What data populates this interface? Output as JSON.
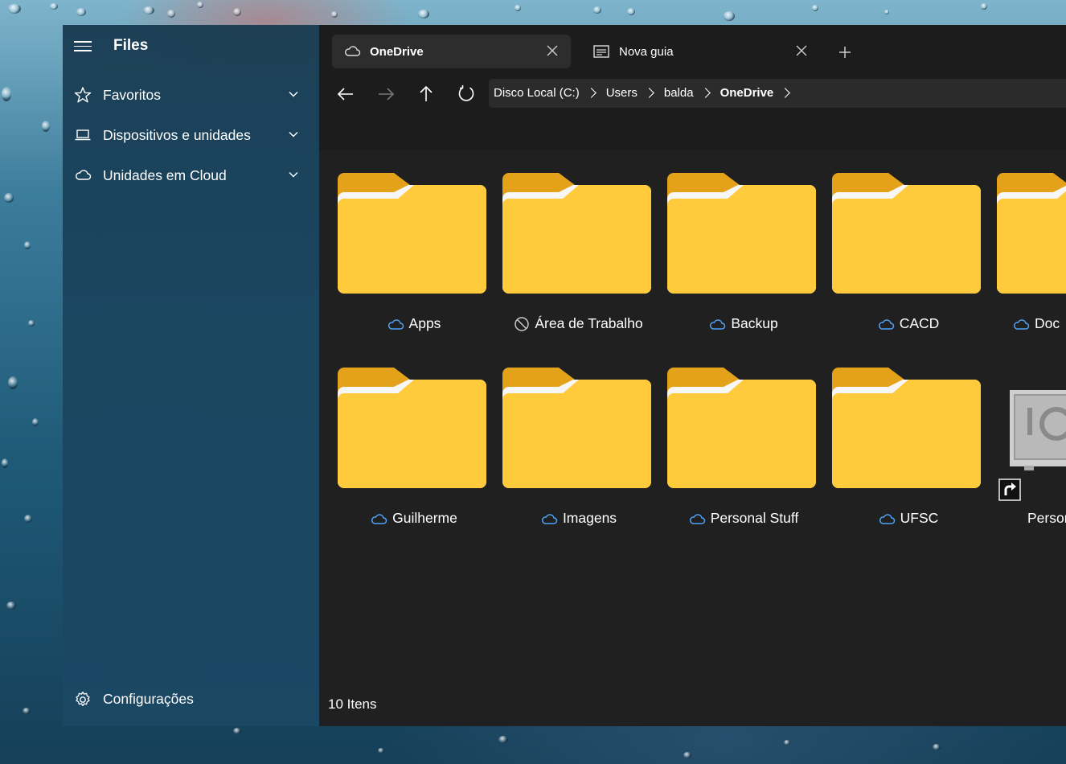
{
  "app": {
    "title": "Files"
  },
  "sidebar": {
    "items": [
      {
        "label": "Favoritos",
        "icon": "star-icon"
      },
      {
        "label": "Dispositivos e unidades",
        "icon": "laptop-icon"
      },
      {
        "label": "Unidades em Cloud",
        "icon": "cloud-icon"
      }
    ],
    "settings": {
      "label": "Configurações",
      "icon": "gear-icon"
    }
  },
  "tabs": [
    {
      "label": "OneDrive",
      "icon": "cloud-icon",
      "active": true
    },
    {
      "label": "Nova guia",
      "icon": "drive-icon",
      "active": false
    }
  ],
  "breadcrumb": [
    "Disco Local (C:)",
    "Users",
    "balda",
    "OneDrive"
  ],
  "items": [
    {
      "name": "Apps",
      "status": "cloud"
    },
    {
      "name": "Área de Trabalho",
      "status": "excluded"
    },
    {
      "name": "Backup",
      "status": "cloud"
    },
    {
      "name": "CACD",
      "status": "cloud"
    },
    {
      "name": "Doc",
      "status": "cloud"
    },
    {
      "name": "Guilherme",
      "status": "cloud"
    },
    {
      "name": "Imagens",
      "status": "cloud"
    },
    {
      "name": "Personal Stuff",
      "status": "cloud"
    },
    {
      "name": "UFSC",
      "status": "cloud"
    },
    {
      "name": "Persor",
      "status": "shortcut"
    }
  ],
  "status_bar": {
    "count": "10 Itens"
  },
  "colors": {
    "folder_light": "#FFD45E",
    "folder_dark": "#E8A700",
    "cloud_status": "#4FA3F7",
    "main_bg": "#202020"
  }
}
